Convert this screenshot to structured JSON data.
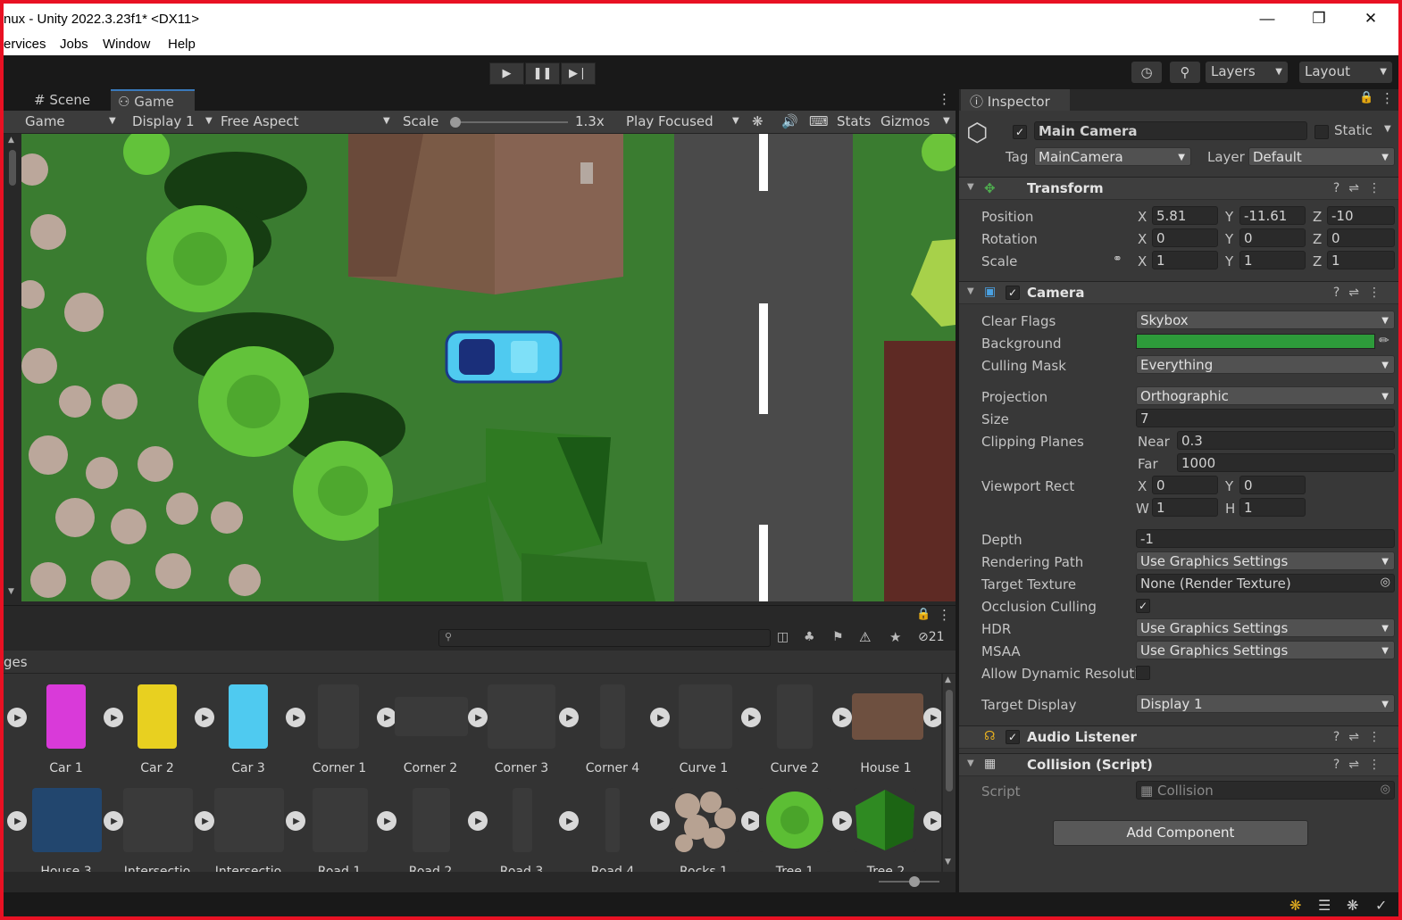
{
  "window": {
    "title": "nux - Unity 2022.3.23f1* <DX11>"
  },
  "menu": [
    "ervices",
    "Jobs",
    "Window",
    "Help"
  ],
  "toolbar": {
    "layers_label": "Layers",
    "layout_label": "Layout"
  },
  "tabs": {
    "scene": "Scene",
    "game": "Game"
  },
  "game_toolbar": {
    "mode": "Game",
    "display": "Display 1",
    "aspect": "Free Aspect",
    "scale_label": "Scale",
    "scale_value": "1.3x",
    "scale_level": 0.0,
    "play_mode": "Play Focused",
    "stats": "Stats",
    "gizmos": "Gizmos"
  },
  "project": {
    "breadcrumb": "ges",
    "hidden_count": "21",
    "row1": [
      "Car 1",
      "Car 2",
      "Car 3",
      "Corner 1",
      "Corner 2",
      "Corner 3",
      "Corner 4",
      "Curve 1",
      "Curve 2",
      "House 1"
    ],
    "row2": [
      "House 3",
      "Intersectio",
      "Intersectio",
      "Road 1",
      "Road 2",
      "Road 3",
      "Road 4",
      "Rocks 1",
      "Tree 1",
      "Tree 2"
    ]
  },
  "inspector": {
    "tab": "Inspector",
    "object_name": "Main Camera",
    "static_label": "Static",
    "tag_label": "Tag",
    "tag_value": "MainCamera",
    "layer_label": "Layer",
    "layer_value": "Default",
    "transform": {
      "title": "Transform",
      "position_label": "Position",
      "pos": {
        "x": "5.81",
        "y": "-11.61",
        "z": "-10"
      },
      "rotation_label": "Rotation",
      "rot": {
        "x": "0",
        "y": "0",
        "z": "0"
      },
      "scale_label": "Scale",
      "scl": {
        "x": "1",
        "y": "1",
        "z": "1"
      }
    },
    "camera": {
      "title": "Camera",
      "clear_flags_label": "Clear Flags",
      "clear_flags": "Skybox",
      "background_label": "Background",
      "background_color": "#2d9b3a",
      "culling_mask_label": "Culling Mask",
      "culling_mask": "Everything",
      "projection_label": "Projection",
      "projection": "Orthographic",
      "size_label": "Size",
      "size": "7",
      "clipping_label": "Clipping Planes",
      "near_label": "Near",
      "near": "0.3",
      "far_label": "Far",
      "far": "1000",
      "viewport_label": "Viewport Rect",
      "vp": {
        "x": "0",
        "y": "0",
        "w": "1",
        "h": "1"
      },
      "depth_label": "Depth",
      "depth": "-1",
      "rendering_path_label": "Rendering Path",
      "rendering_path": "Use Graphics Settings",
      "target_texture_label": "Target Texture",
      "target_texture": "None (Render Texture)",
      "occlusion_label": "Occlusion Culling",
      "hdr_label": "HDR",
      "hdr": "Use Graphics Settings",
      "msaa_label": "MSAA",
      "msaa": "Use Graphics Settings",
      "dynres_label": "Allow Dynamic Resoluti",
      "target_display_label": "Target Display",
      "target_display": "Display 1"
    },
    "audio_listener": {
      "title": "Audio Listener"
    },
    "collision": {
      "title": "Collision (Script)",
      "script_label": "Script",
      "script_value": "Collision"
    },
    "add_component": "Add Component"
  },
  "colors": {
    "accent": "#3a79bb",
    "grass": "#3b7d30",
    "road": "#4a4a4a",
    "car": "#5ad2f0"
  }
}
